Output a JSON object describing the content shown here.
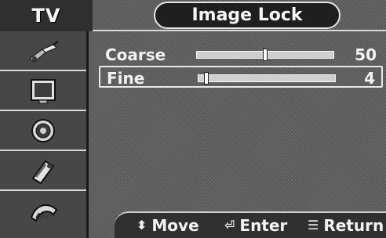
{
  "header": {
    "app_title": "TV",
    "menu_title": "Image Lock"
  },
  "sidebar": {
    "items": [
      {
        "icon": "antenna-plug-icon"
      },
      {
        "icon": "tv-screen-icon"
      },
      {
        "icon": "speaker-icon"
      },
      {
        "icon": "channel-icon"
      },
      {
        "icon": "setup-icon"
      }
    ]
  },
  "settings": [
    {
      "label": "Coarse",
      "value": "50",
      "level": 0.5
    },
    {
      "label": "Fine",
      "value": "4",
      "level": 0.04
    }
  ],
  "footer": {
    "move_label": "Move",
    "enter_label": "Enter",
    "return_label": "Return",
    "move_icon": "up-down-arrows-icon",
    "enter_icon": "enter-icon",
    "return_icon": "menu-icon"
  },
  "colors": {
    "background": "#5d5d5d",
    "panel": "#474747",
    "text": "#f2f2f2",
    "highlight_border": "#e8e8e8"
  }
}
